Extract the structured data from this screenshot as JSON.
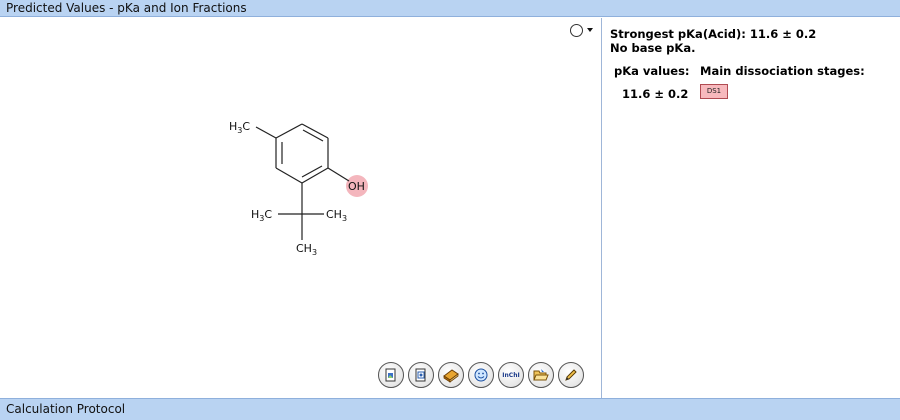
{
  "window": {
    "title": "Predicted Values - pKa and Ion Fractions",
    "footer": "Calculation Protocol"
  },
  "molecule": {
    "labels": {
      "methyl_top_main": "H",
      "methyl_top_sub": "3",
      "methyl_top_c": "C",
      "oh": "OH",
      "left_main": "H",
      "left_sub": "3",
      "left_c": "C",
      "right_c": "CH",
      "right_sub": "3",
      "bottom_c": "CH",
      "bottom_sub": "3"
    },
    "highlight_color": "#f4b6bd"
  },
  "results": {
    "strongest": "Strongest pKa(Acid): 11.6 ± 0.2",
    "no_base": "No base pKa.",
    "pka_header": "pKa values:",
    "stages_header": "Main dissociation stages:",
    "pka_value": "11.6 ± 0.2",
    "ds_label": "DS1",
    "ds_color": "#f7b9bd"
  },
  "toolbar": {
    "buttons": [
      {
        "icon": "copy-image-icon"
      },
      {
        "icon": "copy-structure-icon"
      },
      {
        "icon": "book-icon"
      },
      {
        "icon": "smiley-icon"
      },
      {
        "icon": "inchi-icon",
        "label": "InChI"
      },
      {
        "icon": "open-folder-icon"
      },
      {
        "icon": "pencil-icon"
      }
    ]
  }
}
